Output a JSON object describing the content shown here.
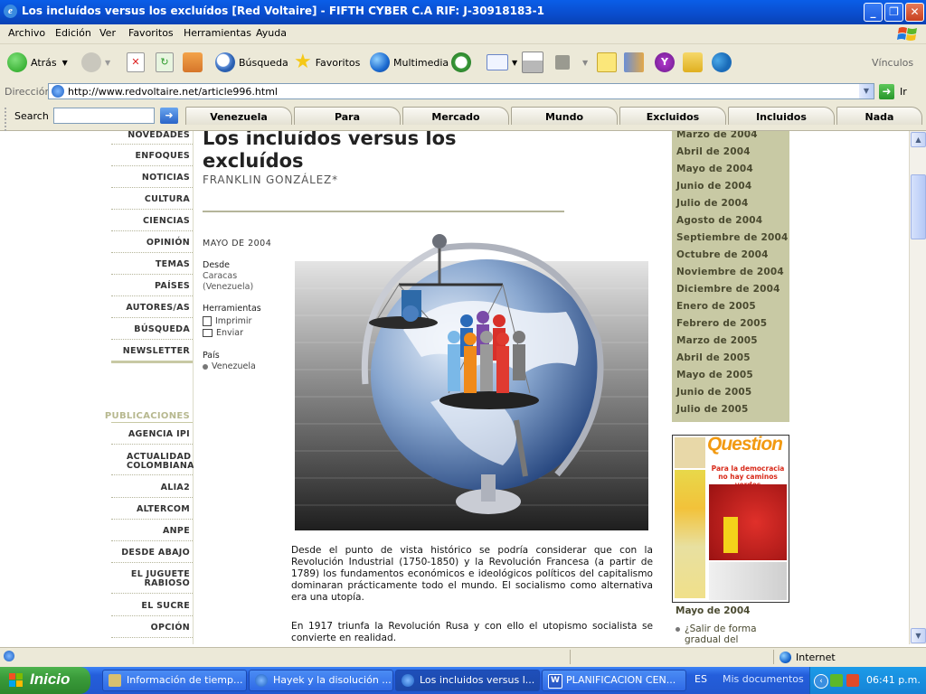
{
  "window": {
    "title": "Los incluídos versus los excluídos [Red Voltaire] - FIFTH CYBER C.A RIF: J-30918183-1"
  },
  "menu": [
    "Archivo",
    "Edición",
    "Ver",
    "Favoritos",
    "Herramientas",
    "Ayuda"
  ],
  "toolbar": {
    "back": "Atrás",
    "search": "Búsqueda",
    "favorites": "Favoritos",
    "media": "Multimedia",
    "links": "Vínculos"
  },
  "address": {
    "label": "Dirección",
    "url": "http://www.redvoltaire.net/article996.html",
    "go": "Ir"
  },
  "searchbar": {
    "label": "Search",
    "tabs": [
      "Venezuela",
      "Para",
      "Mercado",
      "Mundo",
      "Excluidos",
      "Incluidos",
      "Nada"
    ]
  },
  "leftnav": {
    "items": [
      "NOVEDADES",
      "ENFOQUES",
      "NOTICIAS",
      "CULTURA",
      "CIENCIAS",
      "OPINIÓN",
      "TEMAS",
      "PAÍSES",
      "AUTORES/AS",
      "BÚSQUEDA",
      "NEWSLETTER"
    ],
    "pub_heading": "PUBLICACIONES",
    "publications": [
      "AGENCIA IPI",
      "ACTUALIDAD COLOMBIANA",
      "ALIA2",
      "ALTERCOM",
      "ANPE",
      "DESDE ABAJO",
      "EL JUGUETE RABIOSO",
      "EL SUCRE",
      "OPCIÓN"
    ]
  },
  "article": {
    "title": "Los incluídos versus los excluídos",
    "author": "FRANKLIN GONZÁLEZ*",
    "date": "MAYO DE 2004",
    "from_label": "Desde",
    "from_value": "Caracas (Venezuela)",
    "tools_label": "Herramientas",
    "print": "Imprimir",
    "send": "Enviar",
    "country_label": "País",
    "country": "Venezuela",
    "paragraphs": [
      "Desde el punto de vista histórico se podría considerar que con la Revolución Industrial (1750-1850) y la Revolución Francesa (a partir de 1789) los fundamentos económicos e ideológicos políticos del capitalismo dominaran prácticamente todo el mundo. El socialismo como alternativa era una utopía.",
      "En 1917 triunfa la Revolución Rusa y con ello el utopismo socialista se convierte en realidad."
    ]
  },
  "archive": {
    "months": [
      "Marzo de 2004",
      "Abril de 2004",
      "Mayo de 2004",
      "Junio de 2004",
      "Julio de 2004",
      "Agosto de 2004",
      "Septiembre de 2004",
      "Octubre de 2004",
      "Noviembre de 2004",
      "Diciembre de 2004",
      "Enero de 2005",
      "Febrero de 2005",
      "Marzo de 2005",
      "Abril de 2005",
      "Mayo de 2005",
      "Junio de 2005",
      "Julio de 2005"
    ]
  },
  "magazine": {
    "name": "Question",
    "tagline": "Para la democracia no hay caminos verdes",
    "issue": "Mayo de 2004",
    "link": "¿Salir de forma gradual del"
  },
  "status": {
    "zone": "Internet"
  },
  "taskbar": {
    "start": "Inicio",
    "tasks": [
      "Información de tiemp...",
      "Hayek y la disolución ...",
      "Los incluidos versus l...",
      "PLANIFICACION CEN..."
    ],
    "lang": "ES",
    "docs": "Mis documentos",
    "clock": "06:41 p.m."
  },
  "colors": {
    "titlebar": "#0a4ccc",
    "archive_bg": "#c8c9a4",
    "start_green": "#3a9b3a",
    "taskbar_blue": "#245edb"
  }
}
